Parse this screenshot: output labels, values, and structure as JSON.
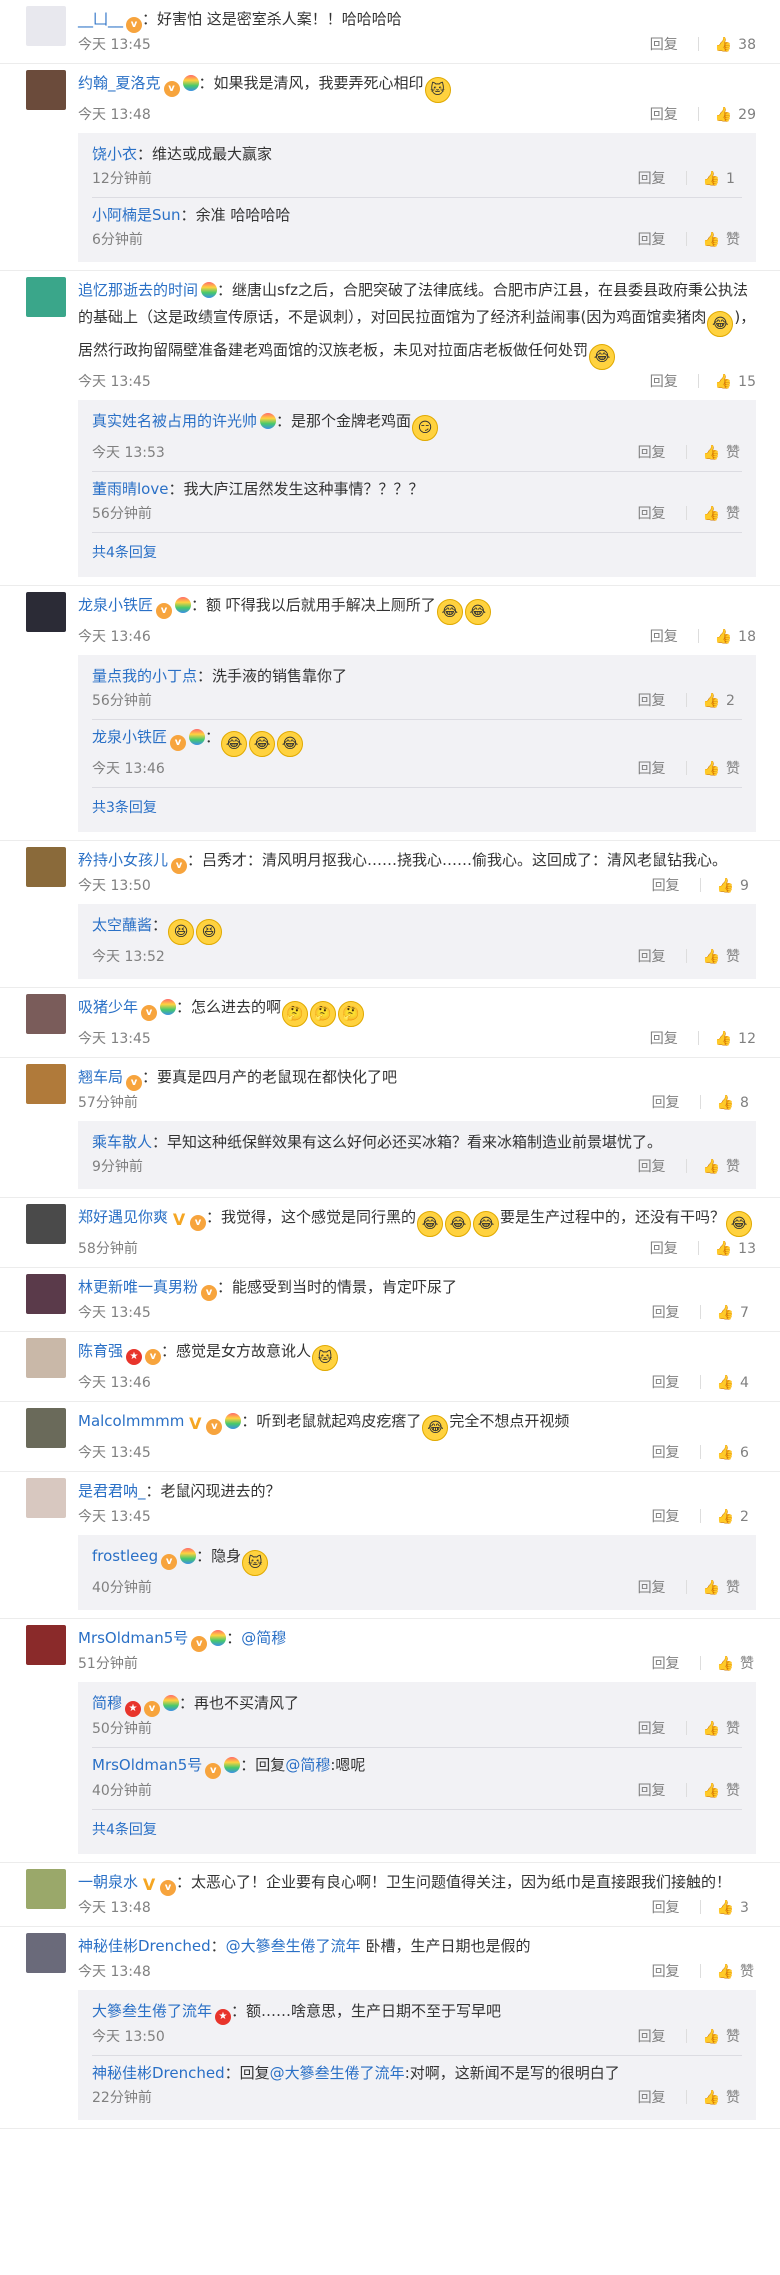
{
  "ui": {
    "reply_label": "回复",
    "like_icon": "thumbs-up-icon"
  },
  "comments": [
    {
      "user": "__凵__",
      "badges": [
        "vip"
      ],
      "text": "好害怕 这是密室杀人案！！哈哈哈哈",
      "time": "今天 13:45",
      "likes": "38",
      "avatar_color": "#e8e8ee",
      "replies": []
    },
    {
      "user": "约翰_夏洛克",
      "badges": [
        "vip",
        "bulb"
      ],
      "text": "如果我是清风，我要弄死心相印",
      "emoji_after": [
        "cat"
      ],
      "time": "今天 13:48",
      "likes": "29",
      "avatar_color": "#6b4b3b",
      "replies": [
        {
          "user": "饶小衣",
          "text": "维达或成最大赢家",
          "time": "12分钟前",
          "likes": "1"
        },
        {
          "user": "小阿楠是Sun",
          "text": "余准 哈哈哈哈",
          "time": "6分钟前",
          "likes": "赞"
        }
      ]
    },
    {
      "user": "追忆那逝去的时间",
      "badges": [
        "bulb"
      ],
      "text": "继唐山sfz之后，合肥突破了法律底线。合肥市庐江县，在县委县政府秉公执法的基础上（这是政绩宣传原话，不是讽刺），对回民拉面馆为了经济利益闹事(因为鸡面馆卖猪肉",
      "emoji_mid": "cry",
      "text2": ")，居然行政拘留隔壁准备建老鸡面馆的汉族老板，未见对拉面店老板做任何处罚",
      "emoji_after": [
        "cry"
      ],
      "time": "今天 13:45",
      "likes": "15",
      "avatar_color": "#3aa68a",
      "replies": [
        {
          "user": "真实姓名被占用的许光帅",
          "badges": [
            "bulb"
          ],
          "text": "是那个金牌老鸡面",
          "emoji_after": [
            "smirk"
          ],
          "time": "今天 13:53",
          "likes": "赞"
        },
        {
          "user": "董雨晴love",
          "text": "我大庐江居然发生这种事情？？？？",
          "time": "56分钟前",
          "likes": "赞"
        }
      ],
      "more": "共4条回复"
    },
    {
      "user": "龙泉小铁匠",
      "badges": [
        "vip",
        "bulb"
      ],
      "text": "额 吓得我以后就用手解决上厕所了",
      "emoji_after": [
        "cry",
        "cry"
      ],
      "time": "今天 13:46",
      "likes": "18",
      "avatar_color": "#2b2b36",
      "replies": [
        {
          "user": "量点我的小丁点",
          "text": "洗手液的销售靠你了",
          "time": "56分钟前",
          "likes": "2"
        },
        {
          "user": "龙泉小铁匠",
          "badges": [
            "vip",
            "bulb"
          ],
          "text": "",
          "emoji_after": [
            "cry",
            "cry",
            "cry"
          ],
          "time": "今天 13:46",
          "likes": "赞"
        }
      ],
      "more": "共3条回复"
    },
    {
      "user": "矜持小女孩儿",
      "badges": [
        "vip"
      ],
      "text": "吕秀才：清风明月抠我心……挠我心……偷我心。这回成了：清风老鼠钻我心。",
      "time": "今天 13:50",
      "likes": "9",
      "avatar_color": "#8a6a3a",
      "replies": [
        {
          "user": "太空蘸酱",
          "text": "",
          "emoji_after": [
            "laugh",
            "laugh"
          ],
          "time": "今天 13:52",
          "likes": "赞"
        }
      ]
    },
    {
      "user": "吸猪少年",
      "badges": [
        "vip",
        "bulb"
      ],
      "text": "怎么进去的啊",
      "emoji_after": [
        "think",
        "think",
        "think"
      ],
      "time": "今天 13:45",
      "likes": "12",
      "avatar_color": "#7a5c5a",
      "replies": []
    },
    {
      "user": "翘车局",
      "badges": [
        "vip"
      ],
      "text": "要真是四月产的老鼠现在都快化了吧",
      "time": "57分钟前",
      "likes": "8",
      "avatar_color": "#b07a3a",
      "replies": [
        {
          "user": "乘车散人",
          "text": "早知这种纸保鲜效果有这么好何必还买冰箱？看来冰箱制造业前景堪忧了。",
          "time": "9分钟前",
          "likes": "赞"
        }
      ]
    },
    {
      "user": "郑好遇见你爽",
      "badges": [
        "v",
        "vip"
      ],
      "text": "我觉得，这个感觉是同行黑的",
      "emoji_mid3": [
        "cry",
        "cry",
        "cry"
      ],
      "text2": "要是生产过程中的，还没有干吗？",
      "emoji_after": [
        "cry"
      ],
      "time": "58分钟前",
      "likes": "13",
      "avatar_color": "#4a4a4a",
      "replies": []
    },
    {
      "user": "林更新唯一真男粉",
      "badges": [
        "vip"
      ],
      "text": "能感受到当时的情景，肯定吓尿了",
      "time": "今天 13:45",
      "likes": "7",
      "avatar_color": "#5a3a4a",
      "replies": []
    },
    {
      "user": "陈育强",
      "badges": [
        "star",
        "vip"
      ],
      "text": "感觉是女方故意讹人",
      "emoji_after": [
        "cat"
      ],
      "time": "今天 13:46",
      "likes": "4",
      "avatar_color": "#c9b8a8",
      "replies": []
    },
    {
      "user": "Malcolmmmm",
      "badges": [
        "v",
        "vip",
        "bulb"
      ],
      "text": "听到老鼠就起鸡皮疙瘩了",
      "emoji_mid": "cry",
      "text2": "完全不想点开视频",
      "time": "今天 13:45",
      "likes": "6",
      "avatar_color": "#6a6a5a",
      "replies": []
    },
    {
      "user": "是君君呐_",
      "text": "老鼠闪现进去的？",
      "time": "今天 13:45",
      "likes": "2",
      "avatar_color": "#d8c8c0",
      "replies": [
        {
          "user": "frostleeg",
          "badges": [
            "vip",
            "bulb"
          ],
          "text": "隐身",
          "emoji_after": [
            "cat"
          ],
          "time": "40分钟前",
          "likes": "赞"
        }
      ]
    },
    {
      "user": "MrsOldman5号",
      "badges": [
        "vip",
        "bulb"
      ],
      "text": "",
      "mention": "@简穆",
      "time": "51分钟前",
      "likes": "赞",
      "avatar_color": "#8a2a2a",
      "replies": [
        {
          "user": "简穆",
          "badges": [
            "star",
            "vip",
            "bulb"
          ],
          "text": "再也不买清风了",
          "time": "50分钟前",
          "likes": "赞"
        },
        {
          "user": "MrsOldman5号",
          "badges": [
            "vip",
            "bulb"
          ],
          "text": "回复",
          "mention": "@简穆",
          "text2": ":嗯呢",
          "time": "40分钟前",
          "likes": "赞"
        }
      ],
      "more": "共4条回复"
    },
    {
      "user": "一朝泉水",
      "badges": [
        "v",
        "vip"
      ],
      "text": "太恶心了！企业要有良心啊！卫生问题值得关注，因为纸巾是直接跟我们接触的！",
      "time": "今天 13:48",
      "likes": "3",
      "avatar_color": "#9aa86a",
      "replies": []
    },
    {
      "user": "神秘佳彬Drenched",
      "badges": [],
      "text": "",
      "mention": "@大篸叁生倦了流年",
      "text2": " 卧槽，生产日期也是假的",
      "time": "今天 13:48",
      "likes": "赞",
      "avatar_color": "#6a6a7a",
      "replies": [
        {
          "user": "大篸叁生倦了流年",
          "badges": [
            "star"
          ],
          "text": "额……啥意思，生产日期不至于写早吧",
          "time": "今天 13:50",
          "likes": "赞"
        },
        {
          "user": "神秘佳彬Drenched",
          "text": "回复",
          "mention": "@大篸叁生倦了流年",
          "text2": ":对啊，这新闻不是写的很明白了",
          "time": "22分钟前",
          "likes": "赞"
        }
      ]
    }
  ]
}
